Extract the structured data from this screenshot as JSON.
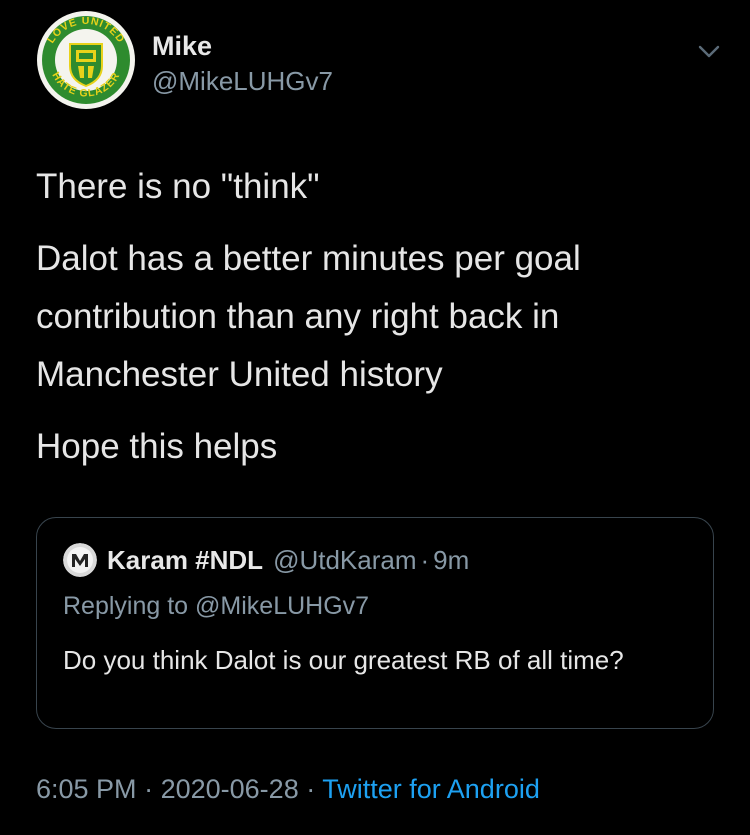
{
  "author": {
    "display_name": "Mike",
    "handle": "@MikeLUHGv7",
    "avatar_text_top": "LOVE UNITED",
    "avatar_text_bottom": "HATE GLAZER",
    "avatar_icon": "united-crest-icon"
  },
  "tweet": {
    "paragraphs": [
      "There is no \"think\"",
      "Dalot has a better minutes per goal contribution than any right back in Manchester United history",
      "Hope this helps"
    ]
  },
  "quote": {
    "display_name": "Karam #NDL",
    "handle": "@UtdKaram",
    "separator": "·",
    "time": "9m",
    "replying_prefix": "Replying to",
    "replying_to": "@MikeLUHGv7",
    "text": "Do you think Dalot is our greatest RB of all time?"
  },
  "footer": {
    "time": "6:05 PM",
    "sep1": "·",
    "date": "2020-06-28",
    "sep2": "·",
    "source": "Twitter for Android"
  },
  "colors": {
    "background": "#000000",
    "muted": "#8899a6",
    "link": "#1da1f2",
    "crest_green": "#2e8b2e",
    "crest_yellow": "#e8d21a"
  }
}
